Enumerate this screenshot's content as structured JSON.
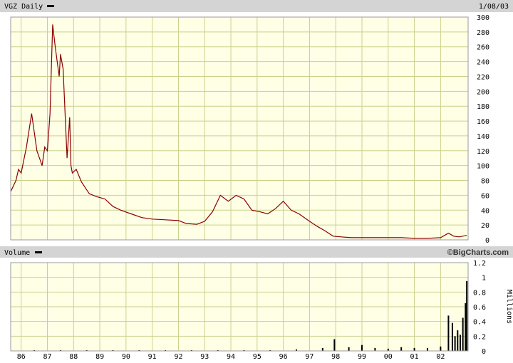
{
  "header": {
    "title": "VGZ Daily",
    "date": "1/08/03"
  },
  "volume_header": {
    "title": "Volume",
    "credit": "©BigCharts.com"
  },
  "colors": {
    "plot_bg": "#ffffe6",
    "grid": "#c8d28c",
    "frame": "#999999",
    "band_bg": "#d4d4d4",
    "price_line": "#8b0000",
    "volume_bar": "#000000"
  },
  "chart_data": [
    {
      "type": "line",
      "title": "VGZ Daily",
      "ylim": [
        0,
        300
      ],
      "xlim": [
        1985.6,
        2003.05
      ],
      "y_ticks": [
        0,
        20,
        40,
        60,
        80,
        100,
        120,
        140,
        160,
        180,
        200,
        220,
        240,
        260,
        280,
        300
      ],
      "x_tick_labels": [
        "86",
        "87",
        "88",
        "89",
        "90",
        "91",
        "92",
        "93",
        "94",
        "95",
        "96",
        "97",
        "98",
        "99",
        "00",
        "01",
        "02"
      ],
      "x_tick_values": [
        1986,
        1987,
        1988,
        1989,
        1990,
        1991,
        1992,
        1993,
        1994,
        1995,
        1996,
        1997,
        1998,
        1999,
        2000,
        2001,
        2002
      ],
      "grid": true,
      "series": [
        {
          "x": [
            1985.6,
            1985.8,
            1985.9,
            1986.0,
            1986.2,
            1986.4,
            1986.6,
            1986.8,
            1986.9,
            1987.0,
            1987.1,
            1987.2,
            1987.3,
            1987.45,
            1987.5,
            1987.6,
            1987.75,
            1987.85,
            1987.9,
            1987.95,
            1988.1,
            1988.3,
            1988.6,
            1988.9,
            1989.2,
            1989.5,
            1989.8,
            1990.2,
            1990.6,
            1991.0,
            1991.5,
            1992.0,
            1992.3,
            1992.7,
            1993.0,
            1993.3,
            1993.6,
            1993.9,
            1994.2,
            1994.5,
            1994.8,
            1995.1,
            1995.4,
            1995.7,
            1996.0,
            1996.3,
            1996.6,
            1997.0,
            1997.3,
            1997.6,
            1997.9,
            1998.2,
            1998.6,
            1999.0,
            1999.5,
            2000.0,
            2000.5,
            2001.0,
            2001.5,
            2002.0,
            2002.3,
            2002.5,
            2002.7,
            2003.0
          ],
          "y": [
            65,
            80,
            95,
            90,
            125,
            170,
            120,
            100,
            125,
            120,
            170,
            290,
            260,
            220,
            250,
            230,
            110,
            165,
            100,
            90,
            95,
            78,
            62,
            58,
            55,
            45,
            40,
            35,
            30,
            28,
            27,
            26,
            22,
            21,
            25,
            38,
            60,
            52,
            60,
            55,
            40,
            38,
            35,
            42,
            52,
            40,
            35,
            25,
            18,
            12,
            5,
            4,
            3,
            3,
            3,
            3,
            3,
            2,
            2,
            3,
            9,
            5,
            4,
            6
          ]
        }
      ]
    },
    {
      "type": "bar",
      "title": "Volume",
      "ylabel": "Millions",
      "ylim": [
        0,
        1.2
      ],
      "y_ticks": [
        0,
        0.2,
        0.4,
        0.6,
        0.8,
        1,
        1.2
      ],
      "grid": true,
      "x": [
        1986.5,
        1987.5,
        1988.5,
        1989.5,
        1990.5,
        1991.5,
        1992.5,
        1993.5,
        1994.5,
        1995.5,
        1996.5,
        1997.5,
        1997.95,
        1998.5,
        1999.0,
        1999.5,
        2000.0,
        2000.5,
        2001.0,
        2001.5,
        2002.0,
        2002.3,
        2002.45,
        2002.55,
        2002.65,
        2002.75,
        2002.85,
        2002.95,
        2003.0
      ],
      "values": [
        0.01,
        0.01,
        0.01,
        0.01,
        0.01,
        0.01,
        0.01,
        0.01,
        0.01,
        0.01,
        0.02,
        0.04,
        0.16,
        0.05,
        0.08,
        0.04,
        0.03,
        0.05,
        0.04,
        0.04,
        0.06,
        0.48,
        0.38,
        0.2,
        0.28,
        0.22,
        0.45,
        0.65,
        0.95
      ]
    }
  ]
}
